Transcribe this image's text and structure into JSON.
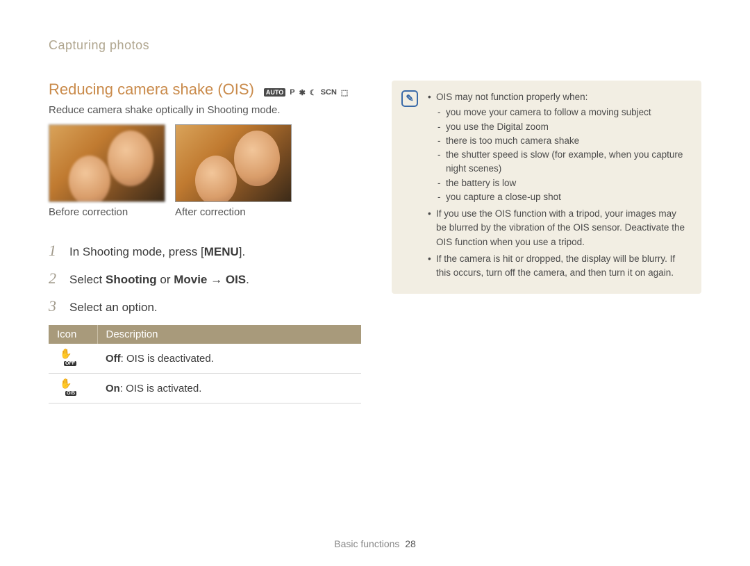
{
  "breadcrumb": "Capturing photos",
  "heading": "Reducing camera shake (OIS)",
  "mode_icons": [
    "AUTO",
    "P",
    "✱",
    "☾",
    "SCN",
    "⬚"
  ],
  "intro": "Reduce camera shake optically in Shooting mode.",
  "caption_before": "Before correction",
  "caption_after": "After correction",
  "steps": {
    "s1_num": "1",
    "s1_a": "In Shooting mode, press [",
    "s1_menu": "MENU",
    "s1_b": "].",
    "s2_num": "2",
    "s2_a": "Select ",
    "s2_b": "Shooting",
    "s2_c": " or ",
    "s2_d": "Movie",
    "s2_e": " → ",
    "s2_f": "OIS",
    "s2_g": ".",
    "s3_num": "3",
    "s3_a": "Select an option."
  },
  "table": {
    "h_icon": "Icon",
    "h_desc": "Description",
    "row1_sub": "OFF",
    "row1_bold": "Off",
    "row1_rest": ": OIS is deactivated.",
    "row2_sub": "OIS",
    "row2_bold": "On",
    "row2_rest": ": OIS is activated."
  },
  "note": {
    "icon": "✎",
    "b1": "OIS may not function properly when:",
    "b1_subs": [
      "you move your camera to follow a moving subject",
      "you use the Digital zoom",
      "there is too much camera shake",
      "the shutter speed is slow (for example, when you capture night scenes)",
      "the battery is low",
      "you capture a close-up shot"
    ],
    "b2": "If you use the OIS function with a tripod, your images may be blurred by the vibration of the OIS sensor. Deactivate the OIS function when you use a tripod.",
    "b3": "If the camera is hit or dropped, the display will be blurry. If this occurs, turn off the camera, and then turn it on again."
  },
  "footer_label": "Basic functions",
  "footer_page": "28"
}
